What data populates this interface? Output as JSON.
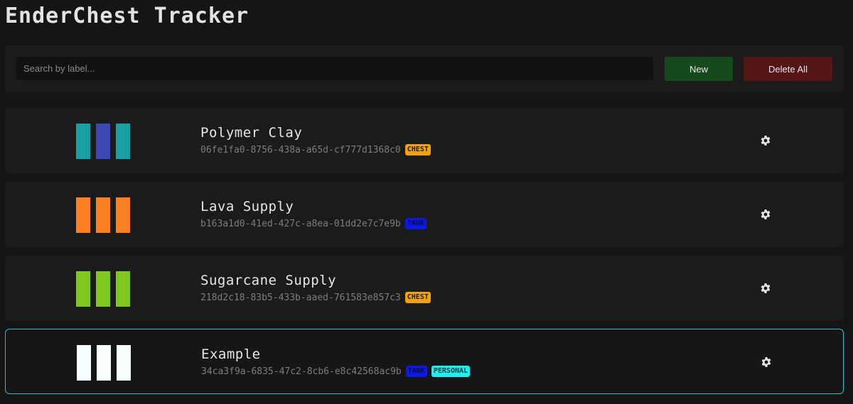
{
  "app": {
    "title": "EnderChest Tracker"
  },
  "toolbar": {
    "search_placeholder": "Search by label...",
    "new_label": "New",
    "delete_all_label": "Delete All"
  },
  "colors": {
    "new_button": "#16491c",
    "delete_button": "#541516",
    "chest_badge": "#f2a20c",
    "tank_badge": "#0c18e4",
    "personal_badge": "#18f0f2",
    "selected_border": "#27c0c6"
  },
  "chests": [
    {
      "label": "Polymer Clay",
      "uuid": "06fe1fa0-8756-438a-a65d-cf777d1368c0",
      "badges": [
        "CHEST"
      ],
      "colors": [
        "#1aa0a3",
        "#3d48b3",
        "#1aa0a3"
      ],
      "selected": false,
      "settings_icon": "gear-icon"
    },
    {
      "label": "Lava Supply",
      "uuid": "b163a1d0-41ed-427c-a8ea-01dd2e7c7e9b",
      "badges": [
        "TANK"
      ],
      "colors": [
        "#fb8021",
        "#fb8021",
        "#fb8021"
      ],
      "selected": false,
      "settings_icon": "gear-icon"
    },
    {
      "label": "Sugarcane Supply",
      "uuid": "218d2c18-83b5-433b-aaed-761583e857c3",
      "badges": [
        "CHEST"
      ],
      "colors": [
        "#80c71f",
        "#80c71f",
        "#80c71f"
      ],
      "selected": false,
      "settings_icon": "gear-icon"
    },
    {
      "label": "Example",
      "uuid": "34ca3f9a-6835-47c2-8cb6-e8c42568ac9b",
      "badges": [
        "TANK",
        "PERSONAL"
      ],
      "colors": [
        "#f8fdfd",
        "#f8fdfd",
        "#f8fdfd"
      ],
      "selected": true,
      "settings_icon": "gear-icon"
    }
  ]
}
